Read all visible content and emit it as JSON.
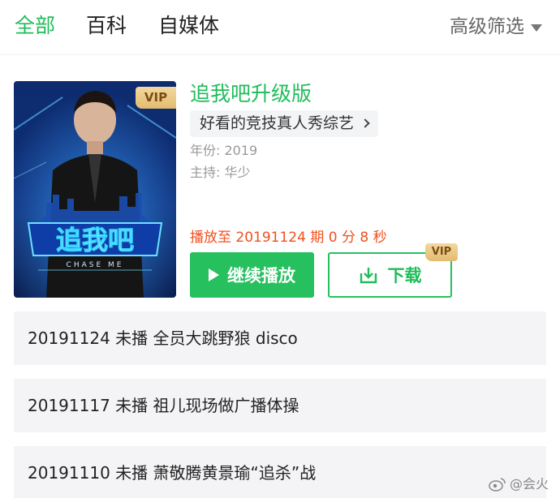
{
  "tabs": [
    {
      "label": "全部",
      "active": true
    },
    {
      "label": "百科",
      "active": false
    },
    {
      "label": "自媒体",
      "active": false
    }
  ],
  "filter": {
    "label": "高级筛选",
    "icon": "caret-down-icon"
  },
  "show": {
    "poster": {
      "badge": "VIP",
      "logo_text": "追我吧",
      "logo_sub": "CHASE ME"
    },
    "title": "追我吧升级版",
    "tag": "好看的竞技真人秀综艺",
    "year": "年份: 2019",
    "host": "主持: 华少",
    "progress": "播放至 20191124 期 0 分 8 秒",
    "play_label": "继续播放",
    "download_label": "下载",
    "download_badge": "VIP"
  },
  "episodes": [
    {
      "text": "20191124 未播 全员大跳野狼 disco"
    },
    {
      "text": "20191117 未播 祖儿现场做广播体操"
    },
    {
      "text": "20191110 未播 萧敬腾黄景瑜“追杀”战"
    }
  ],
  "watermark": {
    "text": "@会火",
    "icon": "weibo-icon"
  },
  "colors": {
    "accent": "#1fbd5a",
    "progress": "#f0501e",
    "vip": "#e3bb6f"
  }
}
